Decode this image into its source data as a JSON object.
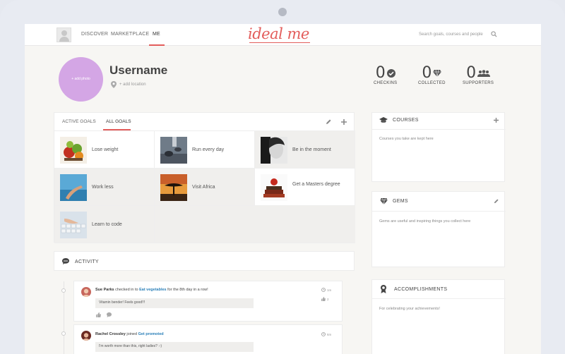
{
  "nav": {
    "discover": "DISCOVER",
    "marketplace": "MARKETPLACE",
    "me": "ME",
    "logo": "ideal me",
    "search_placeholder": "Search goals, courses and people"
  },
  "profile": {
    "add_photo": "+ add photo",
    "username": "Username",
    "add_location": "+ add location"
  },
  "stats": [
    {
      "value": "0",
      "label": "CHECKINS",
      "icon": "checkmark-icon"
    },
    {
      "value": "0",
      "label": "COLLECTED",
      "icon": "gem-icon"
    },
    {
      "value": "0",
      "label": "SUPPORTERS",
      "icon": "people-icon"
    }
  ],
  "goals": {
    "tabs": [
      "ACTIVE GOALS",
      "ALL GOALS"
    ],
    "active_tab": "ALL GOALS",
    "items": [
      {
        "title": "Lose weight"
      },
      {
        "title": "Run every day"
      },
      {
        "title": "Be in the moment"
      },
      {
        "title": "Work less"
      },
      {
        "title": "Visit Africa"
      },
      {
        "title": "Get a Masters degree"
      },
      {
        "title": "Learn to code"
      }
    ]
  },
  "activity": {
    "title": "ACTIVITY",
    "items": [
      {
        "user": "Sue Parks",
        "verb": "checked in to",
        "link": "Eat vegetables",
        "suffix": "for the 8th day in a row!",
        "comment": "Vitamin bender! Feels good!!!",
        "time": "1m",
        "likes": "2"
      },
      {
        "user": "Rachel Crossley",
        "verb": "joined",
        "link": "Get promoted",
        "suffix": "",
        "comment": "I'm worth more than this, right ladies? :-)",
        "time": "6m",
        "likes": ""
      }
    ]
  },
  "sidebar": {
    "courses": {
      "title": "COURSES",
      "body": "Courses you take are kept here"
    },
    "gems": {
      "title": "GEMS",
      "body": "Gems are useful and inspiring things you collect here"
    },
    "accomplishments": {
      "title": "ACCOMPLISHMENTS",
      "body": "For celebrating your achievements!"
    }
  },
  "colors": {
    "accent": "#e35d5b",
    "link": "#2a7fb8",
    "photo_placeholder": "#d4a6e5"
  }
}
